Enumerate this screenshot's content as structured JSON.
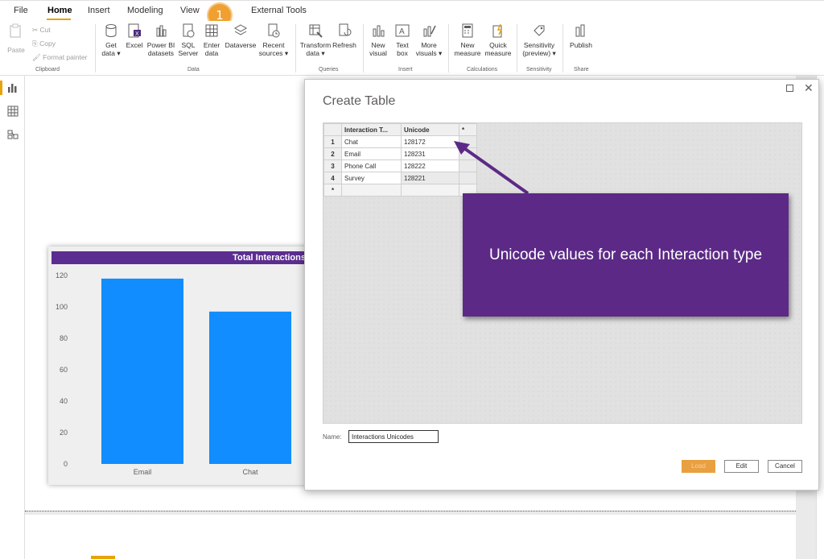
{
  "menu": {
    "items": [
      "File",
      "Home",
      "Insert",
      "Modeling",
      "View",
      "External Tools"
    ],
    "active": "Home",
    "step_badge": "1"
  },
  "ribbon": {
    "clipboard": {
      "paste": "Paste",
      "cut": "Cut",
      "copy": "Copy",
      "format_painter": "Format painter",
      "label": "Clipboard"
    },
    "data": {
      "get_data": [
        "Get",
        "data"
      ],
      "excel": "Excel",
      "power_bi": [
        "Power BI",
        "datasets"
      ],
      "sql": [
        "SQL",
        "Server"
      ],
      "enter": [
        "Enter",
        "data"
      ],
      "dataverse": "Dataverse",
      "recent": [
        "Recent",
        "sources"
      ],
      "label": "Data"
    },
    "queries": {
      "transform": [
        "Transform",
        "data"
      ],
      "refresh": "Refresh",
      "label": "Queries"
    },
    "insert": {
      "new_visual": [
        "New",
        "visual"
      ],
      "text_box": [
        "Text",
        "box"
      ],
      "more_visuals": [
        "More",
        "visuals"
      ],
      "label": "Insert"
    },
    "calculations": {
      "new_measure": [
        "New",
        "measure"
      ],
      "quick_measure": [
        "Quick",
        "measure"
      ],
      "label": "Calculations"
    },
    "sensitivity": {
      "sensitivity": [
        "Sensitivity",
        "(preview)"
      ],
      "label": "Sensitivity"
    },
    "share": {
      "publish": "Publish",
      "label": "Share"
    }
  },
  "colors": {
    "accent": "#e6a30a",
    "brand_purple": "#5c2d91",
    "bar": "#118dff",
    "callout": "#5c2a86"
  },
  "chart_data": {
    "type": "bar",
    "title": "Total Interactions",
    "categories": [
      "Email",
      "Chat"
    ],
    "values": [
      118,
      97
    ],
    "ylim": [
      0,
      120
    ],
    "yticks": [
      0,
      20,
      40,
      60,
      80,
      100,
      120
    ]
  },
  "dialog": {
    "title": "Create Table",
    "columns": [
      "Interaction T...",
      "Unicode",
      "*"
    ],
    "rows": [
      {
        "num": "1",
        "type": "Chat",
        "unicode": "128172"
      },
      {
        "num": "2",
        "type": "Email",
        "unicode": "128231"
      },
      {
        "num": "3",
        "type": "Phone Call",
        "unicode": "128222"
      },
      {
        "num": "4",
        "type": "Survey",
        "unicode": "128221"
      }
    ],
    "new_row_marker": "*",
    "name_label": "Name:",
    "name_value": "Interactions Unicodes",
    "buttons": {
      "load": "Load",
      "edit": "Edit",
      "cancel": "Cancel"
    }
  },
  "callout": {
    "text": "Unicode values for each Interaction type"
  }
}
